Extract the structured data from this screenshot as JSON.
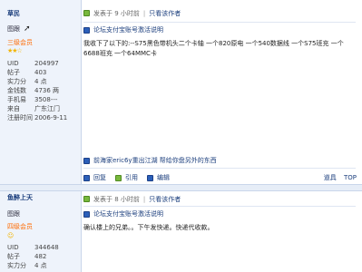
{
  "posts": [
    {
      "author": "草民",
      "avatar_label": "图跟",
      "role": "三级会员",
      "stars": "★★☆",
      "info": [
        {
          "k": "UID",
          "v": "204997"
        },
        {
          "k": "帖子",
          "v": "403"
        },
        {
          "k": "实力分",
          "v": "4 点"
        },
        {
          "k": "金钱数",
          "v": "4736 两"
        },
        {
          "k": "手机易",
          "v": "3508---"
        },
        {
          "k": "来自",
          "v": "广东江门"
        },
        {
          "k": "注册时间",
          "v": "2006-9-11"
        }
      ],
      "posted": "发表于 9 小时前",
      "author_only": "只看该作者",
      "notice": "论坛支付宝账号激活说明",
      "content": "我收下了以下的:--S75黑色带机头二个卡轴 一个820原电 一个540数据线 一个S75班充 一个6688班充 一个64MMC卡",
      "ad": "前海家eric6y重出江湖 帮给你盘另外的东西",
      "actions": {
        "reply": "回复",
        "quote": "引用",
        "edit": "编辑"
      },
      "tools": {
        "props": "道具",
        "top": "TOP"
      }
    },
    {
      "author": "鱼醉上天",
      "avatar_label": "图跟",
      "role": "四级会员",
      "stars": "☺",
      "info": [
        {
          "k": "UID",
          "v": "344648"
        },
        {
          "k": "帖子",
          "v": "482"
        },
        {
          "k": "实力分",
          "v": "4 点"
        },
        {
          "k": "金钱数",
          "v": "..."
        }
      ],
      "posted": "发表于 8 小时前",
      "author_only": "只看该作者",
      "notice": "论坛支付宝账号激活说明",
      "content": "确认楼上的兄弟。。下午发快递。快递代收款。"
    }
  ],
  "colors": {
    "accent": "#1a3d7c",
    "role": "#ff6a00",
    "panel": "#eef3fb"
  }
}
